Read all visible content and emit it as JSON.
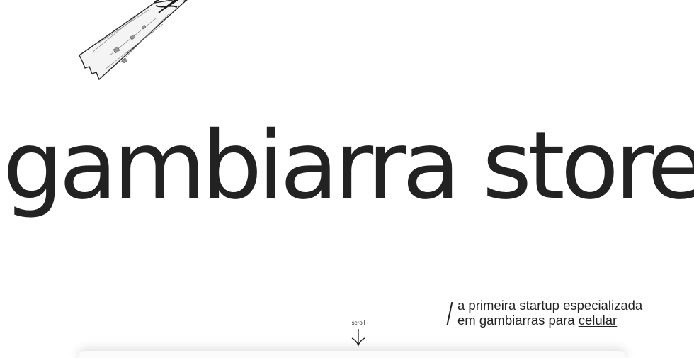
{
  "hero": {
    "title": "gambiarra store"
  },
  "tagline": {
    "line1": "a primeira startup especializada",
    "line2_prefix": "em gambiarras para ",
    "link": "celular"
  },
  "scroll": {
    "label": "scroll",
    "icon": "arrow-down-icon"
  },
  "decoration": {
    "icon": "duct-tape-icon"
  },
  "colors": {
    "text": "#222222",
    "background": "#ffffff"
  }
}
